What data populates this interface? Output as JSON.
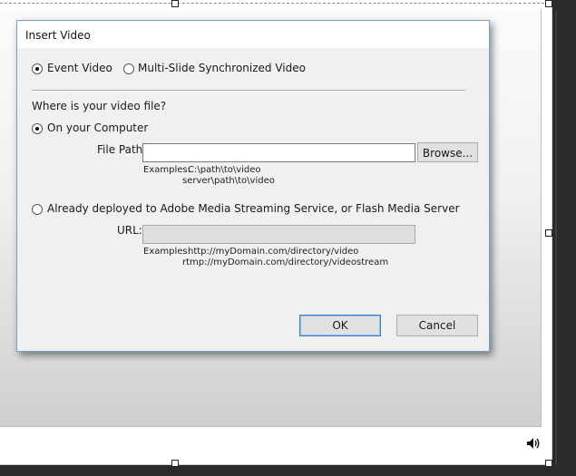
{
  "dialog": {
    "title": "Insert Video",
    "video_type": {
      "options": [
        "Event Video",
        "Multi-Slide Synchronized Video"
      ],
      "selected": "Event Video"
    },
    "location_question": "Where is your video file?",
    "local": {
      "radio_label": "On your Computer",
      "selected": true,
      "file_path_label": "File Path:",
      "file_path_value": "",
      "browse_label": "Browse...",
      "examples_prefix": "Examples:",
      "example_1": "C:\\path\\to\\video",
      "example_2": "server\\path\\to\\video"
    },
    "deployed": {
      "radio_label": "Already deployed to Adobe Media Streaming Service, or Flash Media Server",
      "selected": false,
      "url_label": "URL:",
      "url_value": "",
      "examples_prefix": "Examples:",
      "example_1": "http://myDomain.com/directory/video",
      "example_2": "rtmp://myDomain.com/directory/videostream"
    },
    "ok_label": "OK",
    "cancel_label": "Cancel"
  },
  "stage": {
    "speaker_icon": "speaker-volume-icon"
  },
  "colors": {
    "dialog_border": "#6fa3d6",
    "dialog_bg": "#f0f0f0",
    "window_bg": "#2b2b2b"
  }
}
